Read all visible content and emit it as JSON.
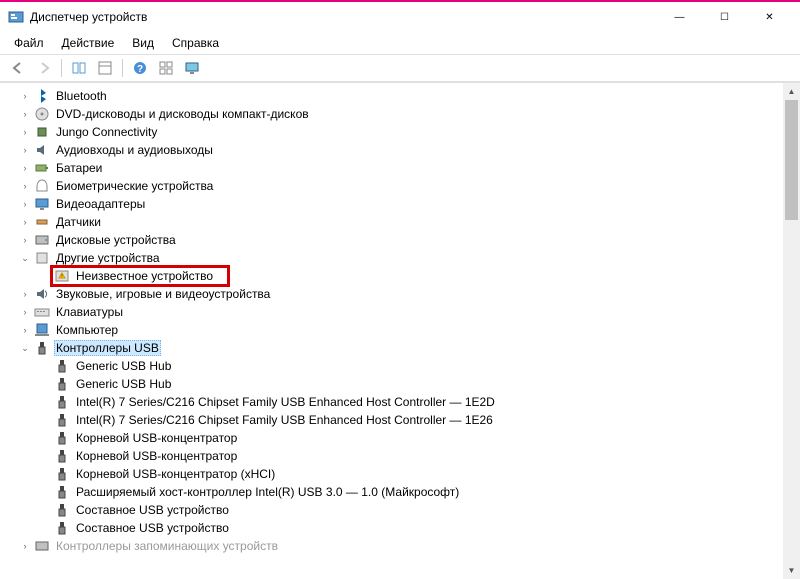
{
  "window": {
    "title": "Диспетчер устройств",
    "controls": {
      "min": "—",
      "max": "☐",
      "close": "✕"
    }
  },
  "menu": {
    "file": "Файл",
    "action": "Действие",
    "view": "Вид",
    "help": "Справка"
  },
  "toolbar": {
    "back": "back",
    "forward": "forward",
    "showhide": "showhide",
    "help": "help",
    "props": "props",
    "monitor": "monitor"
  },
  "tree": {
    "categories": [
      {
        "expander": ">",
        "icon": "bluetooth",
        "label": "Bluetooth"
      },
      {
        "expander": ">",
        "icon": "disc",
        "label": "DVD-дисководы и дисководы компакт-дисков"
      },
      {
        "expander": ">",
        "icon": "chip",
        "label": "Jungo Connectivity"
      },
      {
        "expander": ">",
        "icon": "audio",
        "label": "Аудиовходы и аудиовыходы"
      },
      {
        "expander": ">",
        "icon": "battery",
        "label": "Батареи"
      },
      {
        "expander": ">",
        "icon": "finger",
        "label": "Биометрические устройства"
      },
      {
        "expander": ">",
        "icon": "display",
        "label": "Видеоадаптеры"
      },
      {
        "expander": ">",
        "icon": "sensor",
        "label": "Датчики"
      },
      {
        "expander": ">",
        "icon": "hdd",
        "label": "Дисковые устройства"
      },
      {
        "expander": "v",
        "icon": "other",
        "label": "Другие устройства",
        "children": [
          {
            "icon": "warn",
            "label": "Неизвестное устройство",
            "highlighted": true
          }
        ]
      },
      {
        "expander": ">",
        "icon": "sound",
        "label": "Звуковые, игровые и видеоустройства"
      },
      {
        "expander": ">",
        "icon": "keyboard",
        "label": "Клавиатуры"
      },
      {
        "expander": ">",
        "icon": "computer",
        "label": "Компьютер"
      },
      {
        "expander": "v",
        "icon": "usb",
        "label": "Контроллеры USB",
        "selected": true,
        "children": [
          {
            "icon": "usb",
            "label": "Generic USB Hub"
          },
          {
            "icon": "usb",
            "label": "Generic USB Hub"
          },
          {
            "icon": "usb",
            "label": "Intel(R) 7 Series/C216 Chipset Family USB Enhanced Host Controller — 1E2D"
          },
          {
            "icon": "usb",
            "label": "Intel(R) 7 Series/C216 Chipset Family USB Enhanced Host Controller — 1E26"
          },
          {
            "icon": "usb",
            "label": "Корневой USB-концентратор"
          },
          {
            "icon": "usb",
            "label": "Корневой USB-концентратор"
          },
          {
            "icon": "usb",
            "label": "Корневой USB-концентратор (xHCI)"
          },
          {
            "icon": "usb",
            "label": "Расширяемый хост-контроллер Intel(R) USB 3.0 — 1.0 (Майкрософт)"
          },
          {
            "icon": "usb",
            "label": "Составное USB устройство"
          },
          {
            "icon": "usb",
            "label": "Составное USB устройство"
          }
        ]
      },
      {
        "expander": ">",
        "icon": "storage",
        "label": "Контроллеры запоминающих устройств",
        "cut": true
      }
    ]
  }
}
